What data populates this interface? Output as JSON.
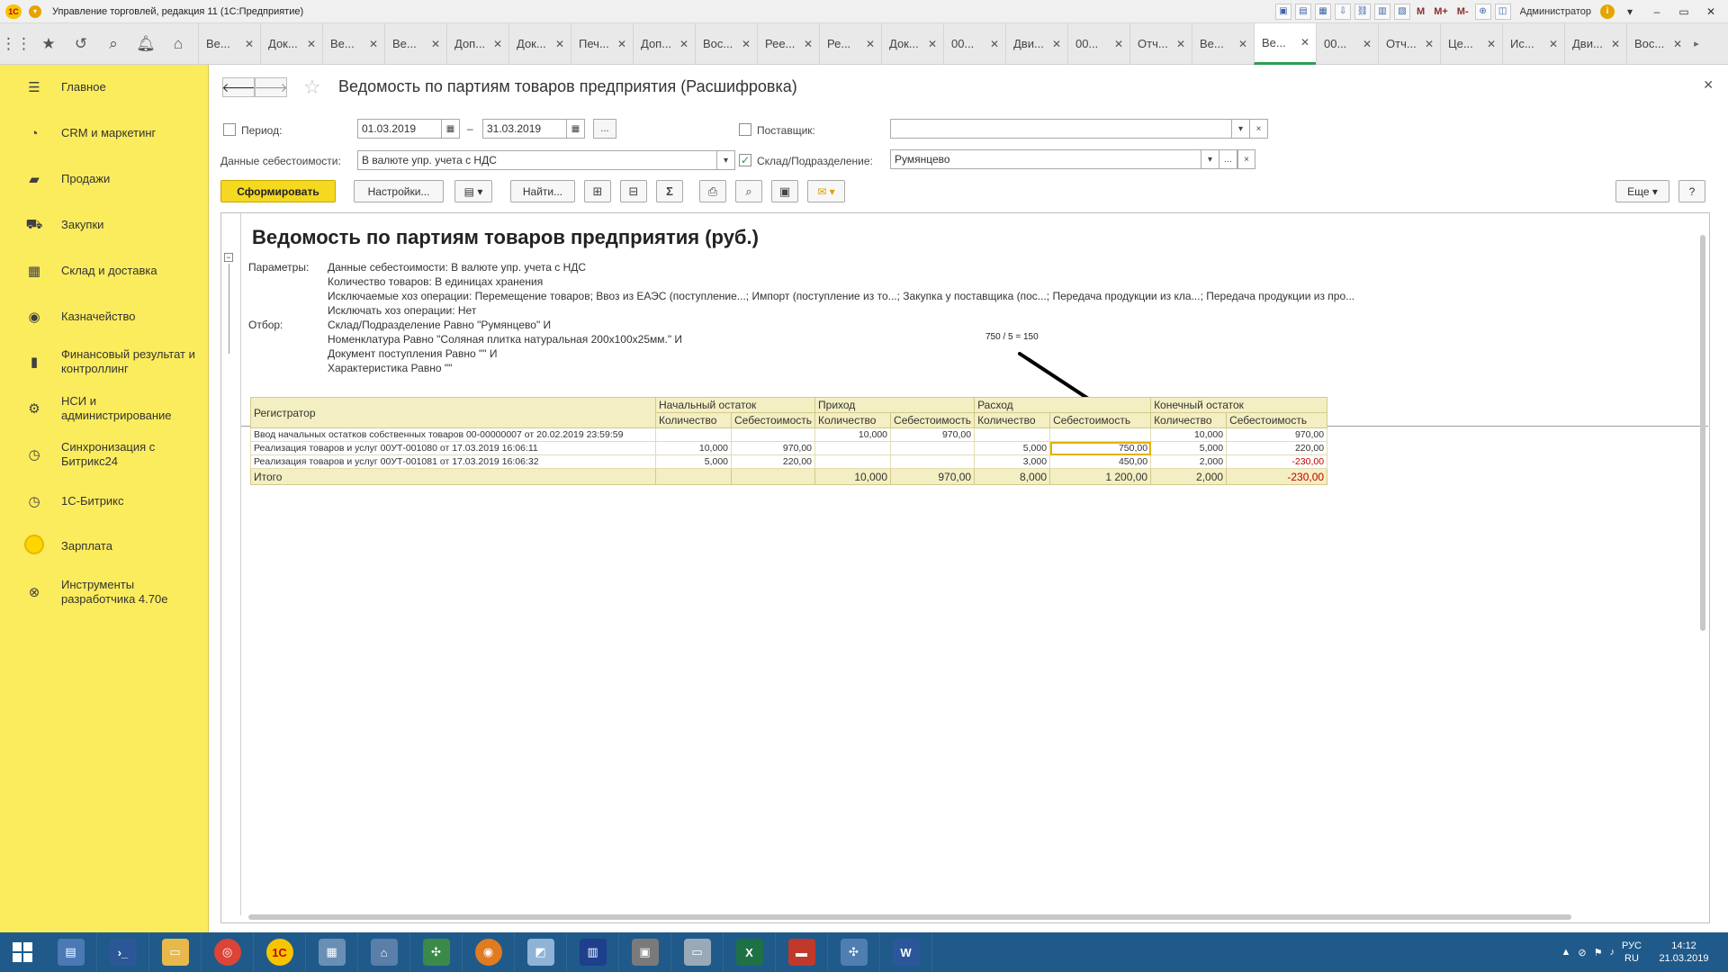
{
  "window": {
    "title": "Управление торговлей, редакция 11  (1С:Предприятие)",
    "user": "Администратор",
    "m_buttons": [
      "M",
      "M+",
      "M-"
    ]
  },
  "tabs": [
    {
      "label": "Ве..."
    },
    {
      "label": "Док..."
    },
    {
      "label": "Ве..."
    },
    {
      "label": "Ве..."
    },
    {
      "label": "Доп..."
    },
    {
      "label": "Док..."
    },
    {
      "label": "Печ..."
    },
    {
      "label": "Доп..."
    },
    {
      "label": "Вос..."
    },
    {
      "label": "Рее..."
    },
    {
      "label": "Ре..."
    },
    {
      "label": "Док..."
    },
    {
      "label": "00..."
    },
    {
      "label": "Дви..."
    },
    {
      "label": "00..."
    },
    {
      "label": "Отч..."
    },
    {
      "label": "Ве..."
    },
    {
      "label": "Ве...",
      "active": true
    },
    {
      "label": "00..."
    },
    {
      "label": "Отч..."
    },
    {
      "label": "Це..."
    },
    {
      "label": "Ис..."
    },
    {
      "label": "Дви..."
    },
    {
      "label": "Вос..."
    }
  ],
  "sidebar": {
    "items": [
      {
        "label": "Главное",
        "icon": "menu-lines-icon"
      },
      {
        "label": "CRM и маркетинг",
        "icon": "pie-chart-icon"
      },
      {
        "label": "Продажи",
        "icon": "shopping-bag-icon"
      },
      {
        "label": "Закупки",
        "icon": "cart-icon"
      },
      {
        "label": "Склад и доставка",
        "icon": "warehouse-icon"
      },
      {
        "label": "Казначейство",
        "icon": "coin-icon"
      },
      {
        "label": "Финансовый результат и контроллинг",
        "icon": "bar-chart-icon"
      },
      {
        "label": "НСИ и администрирование",
        "icon": "gear-icon"
      },
      {
        "label": "Синхронизация с Битрикс24",
        "icon": "sync-icon"
      },
      {
        "label": "1С-Битрикс",
        "icon": "sync-icon"
      },
      {
        "label": "Зарплата",
        "icon": "yellow-circle-icon"
      },
      {
        "label": "Инструменты разработчика 4.70e",
        "icon": "tools-icon"
      }
    ]
  },
  "form": {
    "title": "Ведомость по партиям товаров предприятия (Расшифровка)",
    "period_label": "Период:",
    "period_from": "01.03.2019",
    "period_dash": "–",
    "period_to": "31.03.2019",
    "period_more": "...",
    "supplier_label": "Поставщик:",
    "supplier_value": "",
    "cost_label": "Данные себестоимости:",
    "cost_value": "В валюте упр. учета с НДС",
    "warehouse_label": "Склад/Подразделение:",
    "warehouse_checked": "✓",
    "warehouse_value": "Румянцево",
    "buttons": {
      "generate": "Сформировать",
      "settings": "Настройки...",
      "find": "Найти...",
      "more": "Еще",
      "help": "?"
    }
  },
  "report": {
    "title": "Ведомость по партиям товаров предприятия (руб.)",
    "params": [
      {
        "key": "Параметры:",
        "value": "Данные себестоимости: В валюте упр. учета с НДС"
      },
      {
        "key": "",
        "value": "Количество товаров: В единицах хранения"
      },
      {
        "key": "",
        "value": "Исключаемые хоз операции: Перемещение товаров; Ввоз из ЕАЭС (поступление...; Импорт (поступление из то...; Закупка у поставщика (пос...; Передача продукции из кла...; Передача продукции из про..."
      },
      {
        "key": "",
        "value": "Исключать хоз операции: Нет"
      },
      {
        "key": "Отбор:",
        "value": "Склад/Подразделение Равно \"Румянцево\" И"
      },
      {
        "key": "",
        "value": "Номенклатура Равно \"Соляная плитка натуральная 200x100x25мм.\" И"
      },
      {
        "key": "",
        "value": "Документ поступления Равно \"\" И"
      },
      {
        "key": "",
        "value": "Характеристика Равно \"\""
      }
    ],
    "annotation": "750 / 5 = 150",
    "header": {
      "registrar": "Регистратор",
      "groups": [
        "Начальный остаток",
        "Приход",
        "Расход",
        "Конечный остаток"
      ],
      "sub": [
        "Количество",
        "Себестоимость"
      ]
    },
    "rows": [
      {
        "registrar": "Ввод начальных остатков собственных товаров 00-00000007 от 20.02.2019 23:59:59",
        "cells": [
          "",
          "",
          "10,000",
          "970,00",
          "",
          "",
          "10,000",
          "970,00"
        ]
      },
      {
        "registrar": "Реализация товаров и услуг 00УТ-001080 от 17.03.2019 16:06:11",
        "cells": [
          "10,000",
          "970,00",
          "",
          "",
          "5,000",
          "750,00",
          "5,000",
          "220,00"
        ]
      },
      {
        "registrar": "Реализация товаров и услуг 00УТ-001081 от 17.03.2019 16:06:32",
        "cells": [
          "5,000",
          "220,00",
          "",
          "",
          "3,000",
          "450,00",
          "2,000",
          "-230,00"
        ]
      }
    ],
    "total": {
      "registrar": "Итого",
      "cells": [
        "",
        "",
        "10,000",
        "970,00",
        "8,000",
        "1 200,00",
        "2,000",
        "-230,00"
      ]
    }
  },
  "taskbar": {
    "lang": "РУС",
    "lang2": "RU",
    "time": "14:12",
    "date": "21.03.2019"
  }
}
